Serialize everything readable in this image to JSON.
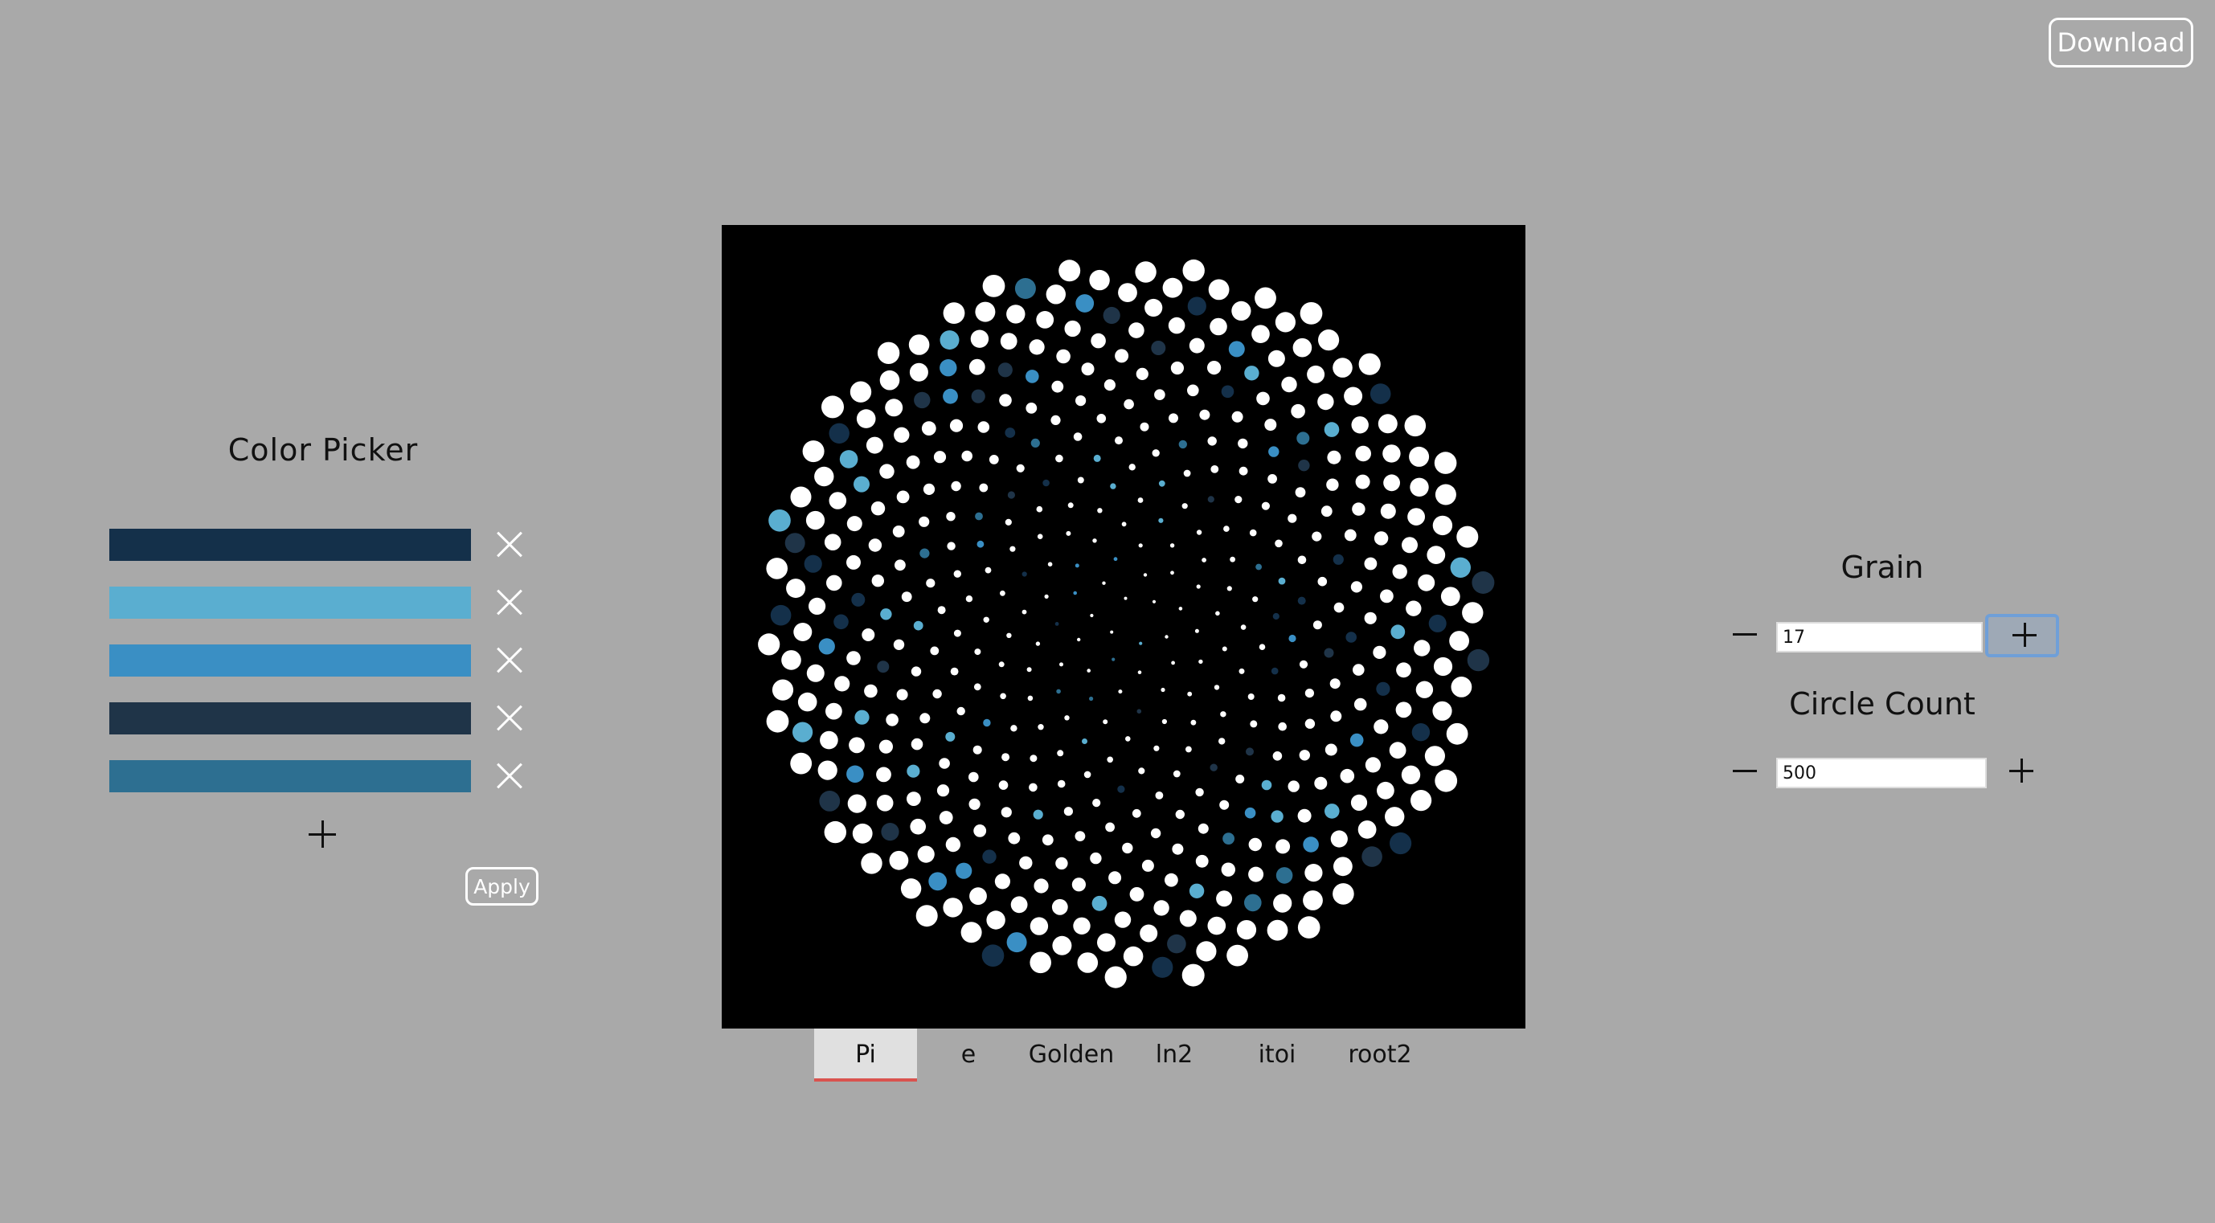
{
  "header": {
    "download_label": "Download"
  },
  "color_picker": {
    "title": "Color Picker",
    "colors": [
      "#14304a",
      "#5aaed0",
      "#3a8fc4",
      "#1f3448",
      "#2d6f91"
    ],
    "apply_label": "Apply"
  },
  "tabs": {
    "items": [
      "Pi",
      "e",
      "Golden",
      "ln2",
      "itoi",
      "root2"
    ],
    "active": "Pi"
  },
  "controls": {
    "grain": {
      "label": "Grain",
      "value": "17"
    },
    "circle_count": {
      "label": "Circle Count",
      "value": "500"
    }
  },
  "canvas": {
    "background": "#000000",
    "dot_colors": [
      "#ffffff",
      "#14304a",
      "#5aaed0",
      "#3a8fc4",
      "#1f3448",
      "#2d6f91"
    ],
    "pattern": "phyllotaxis"
  }
}
